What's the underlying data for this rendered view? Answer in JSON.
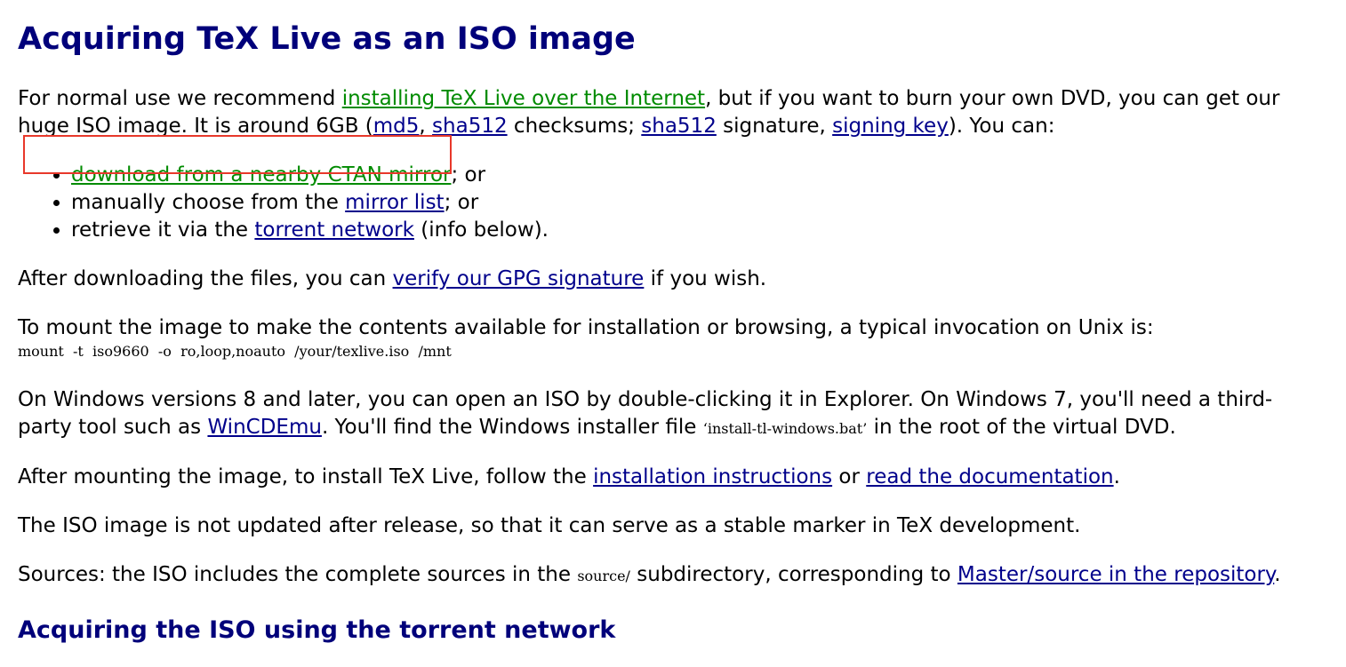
{
  "heading": "Acquiring TeX Live as an ISO image",
  "intro": {
    "t1": "For normal use we recommend ",
    "link_internet": "installing TeX Live over the Internet",
    "t2": ", but if you want to burn your own DVD, you can get our huge ISO image. It is around 6GB (",
    "link_md5": "md5",
    "t3": ", ",
    "link_sha512": "sha512",
    "t4": " checksums; ",
    "link_sha512_sig": "sha512",
    "t5": " signature, ",
    "link_signing_key": "signing key",
    "t6": "). You can:"
  },
  "options": [
    {
      "pre": "",
      "link": "download from a nearby CTAN mirror",
      "post": "; or"
    },
    {
      "pre": "manually choose from the ",
      "link": "mirror list",
      "post": "; or"
    },
    {
      "pre": "retrieve it via the ",
      "link": "torrent network",
      "post": " (info below)."
    }
  ],
  "verify": {
    "t1": "After downloading the files, you can ",
    "link": "verify our GPG signature",
    "t2": " if you wish."
  },
  "mount": {
    "text": "To mount the image to make the contents available for installation or browsing, a typical invocation on Unix is:",
    "command": "mount  -t  iso9660  -o  ro,loop,noauto  /your/texlive.iso  /mnt"
  },
  "windows": {
    "t1": "On Windows versions 8 and later, you can open an ISO by double-clicking it in Explorer. On Windows 7, you'll need a third-party tool such as ",
    "link": "WinCDEmu",
    "t2": ". You'll find the Windows installer file ",
    "file": "‘install-tl-windows.bat’",
    "t3": " in the root of the virtual DVD."
  },
  "after_mount": {
    "t1": "After mounting the image, to install TeX Live, follow the ",
    "link_instructions": "installation instructions",
    "t2": " or ",
    "link_docs": "read the documentation",
    "t3": "."
  },
  "not_updated": "The ISO image is not updated after release, so that it can serve as a stable marker in TeX development.",
  "sources": {
    "t1": "Sources: the ISO includes the complete sources in the ",
    "dir": "source/",
    "t2": " subdirectory, corresponding to ",
    "link": "Master/source in the repository",
    "t3": "."
  },
  "subheading": "Acquiring the ISO using the torrent network",
  "colors": {
    "heading": "#00007a",
    "link": "#00008b",
    "visited_link": "#008b00",
    "highlight_box": "#e8382a"
  }
}
